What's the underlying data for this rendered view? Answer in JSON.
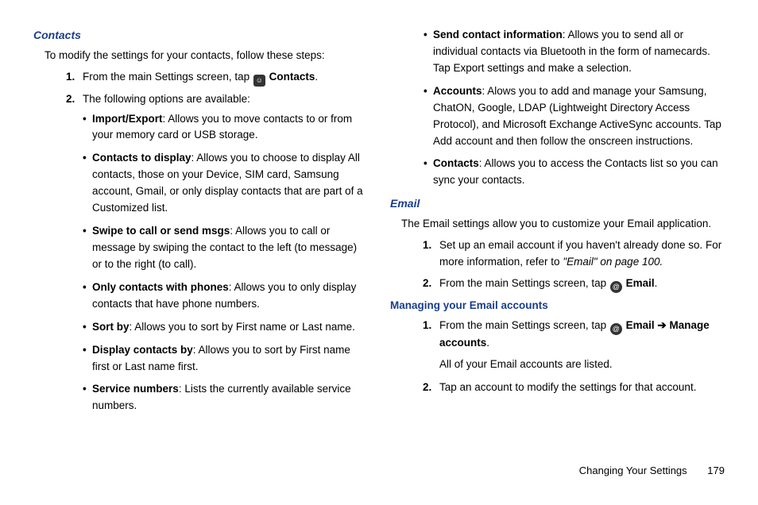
{
  "left": {
    "heading": "Contacts",
    "intro": "To modify the settings for your contacts, follow these steps:",
    "step1_prefix": "From the main Settings screen, tap ",
    "step1_label": "Contacts",
    "step2": "The following options are available:",
    "items": [
      {
        "b": "Import/Export",
        "t": ": Allows you to move contacts to or from your memory card or USB storage."
      },
      {
        "b": "Contacts to display",
        "t": ": Allows you to choose to display All contacts, those on your Device, SIM card, Samsung account, Gmail, or only display contacts that are part of a Customized list."
      },
      {
        "b": "Swipe to call or send msgs",
        "t": ": Allows you to call or message by swiping the contact to the left (to message) or to the right (to call)."
      },
      {
        "b": "Only contacts with phones",
        "t": ": Allows you to only display contacts that have phone numbers."
      },
      {
        "b": "Sort by",
        "t": ": Allows you to sort by First name or Last name."
      },
      {
        "b": "Display contacts by",
        "t": ": Allows you to sort by First name first or Last name first."
      },
      {
        "b": "Service numbers",
        "t": ": Lists the currently available service numbers."
      }
    ]
  },
  "right": {
    "cont_items": [
      {
        "b": "Send contact information",
        "t": ": Allows you to send all or individual contacts via Bluetooth in the form of namecards. Tap Export settings and make a selection."
      },
      {
        "b": "Accounts",
        "t": ": Alows you to add and manage your Samsung, ChatON, Google, LDAP (Lightweight Directory Access Protocol), and Microsoft Exchange ActiveSync accounts. Tap Add account and then follow the onscreen instructions."
      },
      {
        "b": "Contacts",
        "t": ": Allows you to access the Contacts list so you can sync your contacts."
      }
    ],
    "email_heading": "Email",
    "email_intro": "The Email settings allow you to customize your Email application.",
    "email_step1_a": "Set up an email account if you haven't already done so. For more information, refer to ",
    "email_step1_ref": "\"Email\"  on page 100.",
    "email_step2_prefix": "From the main Settings screen, tap ",
    "email_step2_label": "Email",
    "managing_heading": "Managing your Email accounts",
    "m_step1_prefix": "From the main Settings screen, tap ",
    "m_step1_email": "Email",
    "m_step1_arrow": "➔",
    "m_step1_manage": "Manage accounts",
    "m_step1_note": "All of your Email accounts are listed.",
    "m_step2": "Tap an account to modify the settings for that account."
  },
  "footer": {
    "title": "Changing Your Settings",
    "page": "179"
  },
  "icons": {
    "contacts": "☺",
    "email": "@"
  }
}
